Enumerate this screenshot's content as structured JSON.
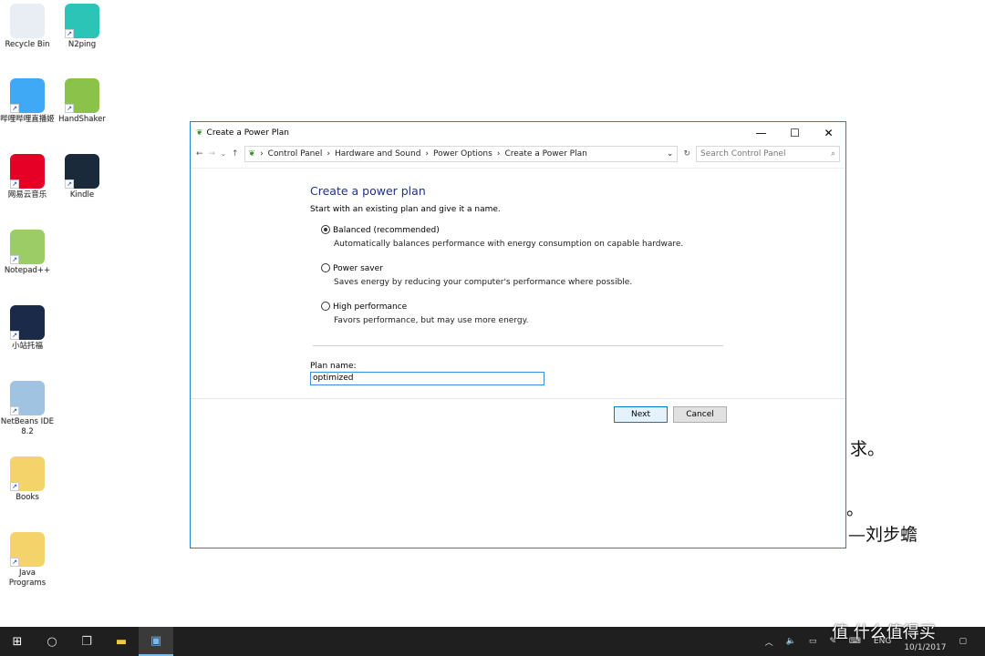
{
  "desktop": {
    "icons": [
      {
        "label": "Recycle Bin",
        "color": "#e8eef4"
      },
      {
        "label": "N2ping",
        "color": "#2bc4b6"
      },
      {
        "label": "哔哩哔哩直播姬",
        "color": "#3fa9f5"
      },
      {
        "label": "HandShaker",
        "color": "#8bc34a"
      },
      {
        "label": "网易云音乐",
        "color": "#e60026"
      },
      {
        "label": "Kindle",
        "color": "#1b2a3a"
      },
      {
        "label": "Notepad++",
        "color": "#9ccc65"
      },
      {
        "label": "小站托福",
        "color": "#1c2a4a"
      },
      {
        "label": "NetBeans IDE 8.2",
        "color": "#9fc3e0"
      },
      {
        "label": "Books",
        "color": "#f5d36b"
      },
      {
        "label": "Java Programs",
        "color": "#f5d36b"
      }
    ]
  },
  "window": {
    "title": "Create a Power Plan",
    "breadcrumb": [
      "Control Panel",
      "Hardware and Sound",
      "Power Options",
      "Create a Power Plan"
    ],
    "search_placeholder": "Search Control Panel",
    "heading": "Create a power plan",
    "intro": "Start with an existing plan and give it a name.",
    "options": [
      {
        "label": "Balanced (recommended)",
        "desc": "Automatically balances performance with energy consumption on capable hardware.",
        "selected": true
      },
      {
        "label": "Power saver",
        "desc": "Saves energy by reducing your computer's performance where possible.",
        "selected": false
      },
      {
        "label": "High performance",
        "desc": "Favors performance, but may use more energy.",
        "selected": false
      }
    ],
    "plan_name_label": "Plan name:",
    "plan_name_value": "optimized",
    "next_label": "Next",
    "cancel_label": "Cancel"
  },
  "background_text": {
    "line1": "求。",
    "line2": "。",
    "line3": "—刘步蟾"
  },
  "taskbar": {
    "lang": "ENG",
    "date": "10/1/2017",
    "watermark": "值 什么值得买"
  }
}
